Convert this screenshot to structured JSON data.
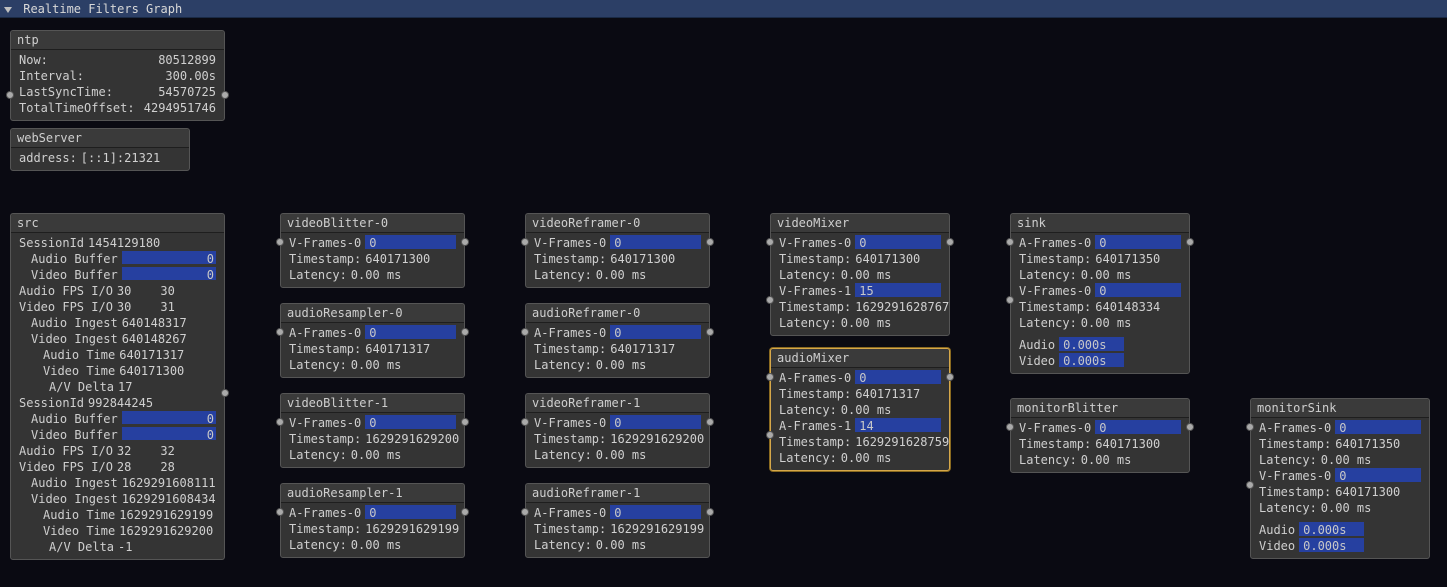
{
  "title": "Realtime Filters Graph",
  "ntp": {
    "header": "ntp",
    "now_label": "Now:",
    "now": "80512899",
    "interval_label": "Interval:",
    "interval": "300.00s",
    "lastsync_label": "LastSyncTime:",
    "lastsync": "54570725",
    "offset_label": "TotalTimeOffset:",
    "offset": "4294951746"
  },
  "webServer": {
    "header": "webServer",
    "address_label": "address:",
    "address": "[::1]:21321"
  },
  "src": {
    "header": "src",
    "sessions": [
      {
        "id_label": "SessionId",
        "id": "1454129180",
        "audio_buffer_label": "Audio Buffer",
        "audio_buffer": "0",
        "video_buffer_label": "Video Buffer",
        "video_buffer": "0",
        "audio_fps_label": "Audio FPS I/O",
        "audio_fps_a": "30",
        "audio_fps_b": "30",
        "video_fps_label": "Video FPS I/O",
        "video_fps_a": "30",
        "video_fps_b": "31",
        "audio_ingest_label": "Audio Ingest",
        "audio_ingest": "640148317",
        "video_ingest_label": "Video Ingest",
        "video_ingest": "640148267",
        "audio_time_label": "Audio Time",
        "audio_time": "640171317",
        "video_time_label": "Video Time",
        "video_time": "640171300",
        "av_delta_label": "A/V Delta",
        "av_delta": "17"
      },
      {
        "id_label": "SessionId",
        "id": "992844245",
        "audio_buffer_label": "Audio Buffer",
        "audio_buffer": "0",
        "video_buffer_label": "Video Buffer",
        "video_buffer": "0",
        "audio_fps_label": "Audio FPS I/O",
        "audio_fps_a": "32",
        "audio_fps_b": "32",
        "video_fps_label": "Video FPS I/O",
        "video_fps_a": "28",
        "video_fps_b": "28",
        "audio_ingest_label": "Audio Ingest",
        "audio_ingest": "1629291608111",
        "video_ingest_label": "Video Ingest",
        "video_ingest": "1629291608434",
        "audio_time_label": "Audio Time",
        "audio_time": "1629291629199",
        "video_time_label": "Video Time",
        "video_time": "1629291629200",
        "av_delta_label": "A/V Delta",
        "av_delta": "-1"
      }
    ]
  },
  "videoBlitter0": {
    "header": "videoBlitter-0",
    "frames_label": "V-Frames-0",
    "frames": "0",
    "ts_label": "Timestamp:",
    "ts": "640171300",
    "lat_label": "Latency:",
    "lat": "0.00 ms"
  },
  "audioResampler0": {
    "header": "audioResampler-0",
    "frames_label": "A-Frames-0",
    "frames": "0",
    "ts_label": "Timestamp:",
    "ts": "640171317",
    "lat_label": "Latency:",
    "lat": "0.00 ms"
  },
  "videoBlitter1": {
    "header": "videoBlitter-1",
    "frames_label": "V-Frames-0",
    "frames": "0",
    "ts_label": "Timestamp:",
    "ts": "1629291629200",
    "lat_label": "Latency:",
    "lat": "0.00 ms"
  },
  "audioResampler1": {
    "header": "audioResampler-1",
    "frames_label": "A-Frames-0",
    "frames": "0",
    "ts_label": "Timestamp:",
    "ts": "1629291629199",
    "lat_label": "Latency:",
    "lat": "0.00 ms"
  },
  "videoReframer0": {
    "header": "videoReframer-0",
    "frames_label": "V-Frames-0",
    "frames": "0",
    "ts_label": "Timestamp:",
    "ts": "640171300",
    "lat_label": "Latency:",
    "lat": "0.00 ms"
  },
  "audioReframer0": {
    "header": "audioReframer-0",
    "frames_label": "A-Frames-0",
    "frames": "0",
    "ts_label": "Timestamp:",
    "ts": "640171317",
    "lat_label": "Latency:",
    "lat": "0.00 ms"
  },
  "videoReframer1": {
    "header": "videoReframer-1",
    "frames_label": "V-Frames-0",
    "frames": "0",
    "ts_label": "Timestamp:",
    "ts": "1629291629200",
    "lat_label": "Latency:",
    "lat": "0.00 ms"
  },
  "audioReframer1": {
    "header": "audioReframer-1",
    "frames_label": "A-Frames-0",
    "frames": "0",
    "ts_label": "Timestamp:",
    "ts": "1629291629199",
    "lat_label": "Latency:",
    "lat": "0.00 ms"
  },
  "videoMixer": {
    "header": "videoMixer",
    "f0_label": "V-Frames-0",
    "f0": "0",
    "ts0_label": "Timestamp:",
    "ts0": "640171300",
    "lat0_label": "Latency:",
    "lat0": "0.00 ms",
    "f1_label": "V-Frames-1",
    "f1": "15",
    "ts1_label": "Timestamp:",
    "ts1": "1629291628767",
    "lat1_label": "Latency:",
    "lat1": "0.00 ms"
  },
  "audioMixer": {
    "header": "audioMixer",
    "f0_label": "A-Frames-0",
    "f0": "0",
    "ts0_label": "Timestamp:",
    "ts0": "640171317",
    "lat0_label": "Latency:",
    "lat0": "0.00 ms",
    "f1_label": "A-Frames-1",
    "f1": "14",
    "ts1_label": "Timestamp:",
    "ts1": "1629291628759",
    "lat1_label": "Latency:",
    "lat1": "0.00 ms"
  },
  "sink": {
    "header": "sink",
    "af_label": "A-Frames-0",
    "af": "0",
    "ats_label": "Timestamp:",
    "ats": "640171350",
    "alat_label": "Latency:",
    "alat": "0.00 ms",
    "vf_label": "V-Frames-0",
    "vf": "0",
    "vts_label": "Timestamp:",
    "vts": "640148334",
    "vlat_label": "Latency:",
    "vlat": "0.00 ms",
    "audio_label": "Audio",
    "audio": "0.000s",
    "video_label": "Video",
    "video": "0.000s"
  },
  "monitorBlitter": {
    "header": "monitorBlitter",
    "vf_label": "V-Frames-0",
    "vf": "0",
    "vts_label": "Timestamp:",
    "vts": "640171300",
    "vlat_label": "Latency:",
    "vlat": "0.00 ms"
  },
  "monitorSink": {
    "header": "monitorSink",
    "af_label": "A-Frames-0",
    "af": "0",
    "ats_label": "Timestamp:",
    "ats": "640171350",
    "alat_label": "Latency:",
    "alat": "0.00 ms",
    "vf_label": "V-Frames-0",
    "vf": "0",
    "vts_label": "Timestamp:",
    "vts": "640171300",
    "vlat_label": "Latency:",
    "vlat": "0.00 ms",
    "audio_label": "Audio",
    "audio": "0.000s",
    "video_label": "Video",
    "video": "0.000s"
  }
}
